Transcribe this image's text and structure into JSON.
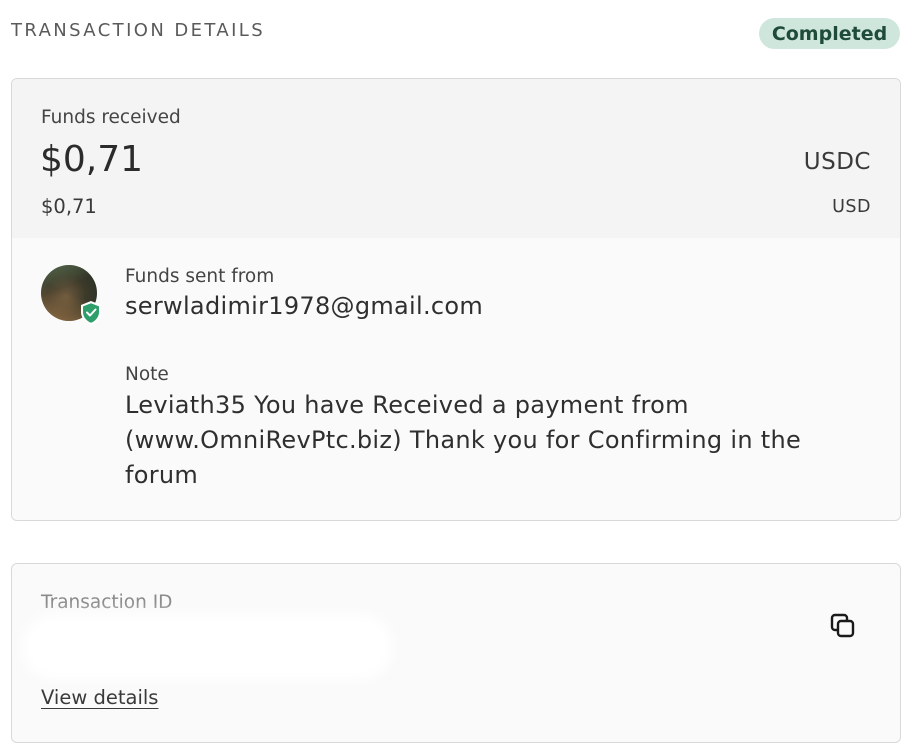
{
  "header": {
    "title": "TRANSACTION DETAILS",
    "status": "Completed"
  },
  "funds": {
    "label": "Funds received",
    "amount": "$0,71",
    "currency": "USDC",
    "amount_converted": "$0,71",
    "currency_converted": "USD"
  },
  "sender": {
    "label": "Funds sent from",
    "email": "serwladimir1978@gmail.com",
    "avatar_icon": "avatar-photo",
    "badge_icon": "verified-shield-icon"
  },
  "note": {
    "label": "Note",
    "text": "Leviath35 You have Received a payment from (www.OmniRevPtc.biz) Thank you for Confirming in the forum"
  },
  "transaction": {
    "label": "Transaction ID",
    "copy_icon": "copy-icon",
    "view_details": "View details"
  },
  "colors": {
    "badge_bg": "#cfe6dc",
    "badge_text": "#1e4b3a",
    "shield": "#2e9e6a"
  }
}
